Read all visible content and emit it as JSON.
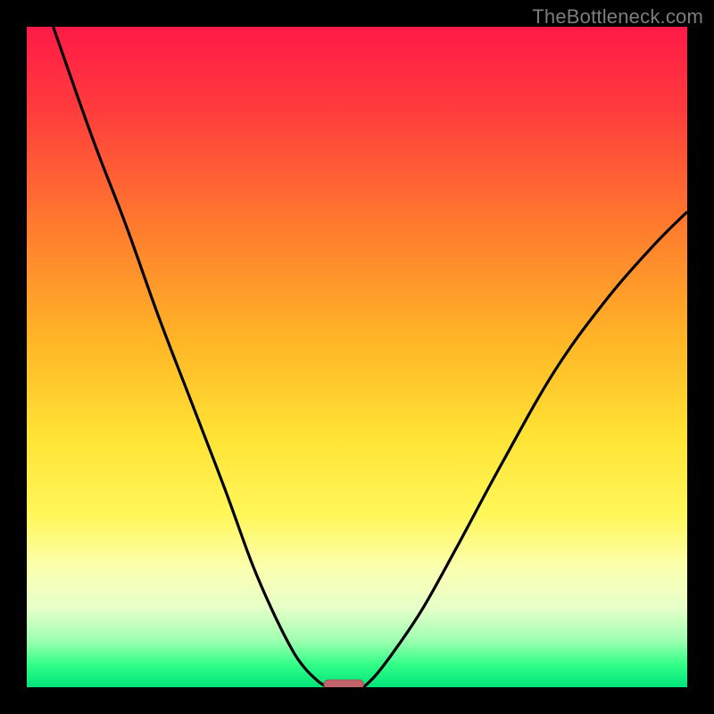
{
  "attribution": "TheBottleneck.com",
  "colors": {
    "frame": "#000000",
    "curve": "#000000",
    "marker_fill": "#c1636a",
    "marker_stroke": "#b04f56",
    "gradient_stops": [
      {
        "offset": 0.0,
        "color": "#ff1a47"
      },
      {
        "offset": 0.12,
        "color": "#ff3a3d"
      },
      {
        "offset": 0.3,
        "color": "#ff7a2e"
      },
      {
        "offset": 0.48,
        "color": "#ffb726"
      },
      {
        "offset": 0.62,
        "color": "#ffe334"
      },
      {
        "offset": 0.74,
        "color": "#fff75a"
      },
      {
        "offset": 0.82,
        "color": "#fbffb0"
      },
      {
        "offset": 0.88,
        "color": "#e6ffc9"
      },
      {
        "offset": 0.93,
        "color": "#9cffb0"
      },
      {
        "offset": 0.965,
        "color": "#33ff88"
      },
      {
        "offset": 1.0,
        "color": "#00e47a"
      }
    ]
  },
  "chart_data": {
    "type": "line",
    "title": "",
    "xlabel": "",
    "ylabel": "",
    "xlim": [
      0,
      100
    ],
    "ylim": [
      0,
      100
    ],
    "series": [
      {
        "name": "left-curve",
        "x": [
          4,
          10,
          15,
          20,
          25,
          30,
          34,
          37,
          40,
          42,
          44,
          45.5
        ],
        "values": [
          100,
          83,
          70,
          56,
          43,
          30,
          19,
          12,
          6,
          3,
          1,
          0
        ]
      },
      {
        "name": "right-curve",
        "x": [
          51,
          53,
          56,
          60,
          65,
          72,
          80,
          88,
          95,
          100
        ],
        "values": [
          0,
          2,
          6,
          12,
          21,
          34,
          48,
          59,
          67,
          72
        ]
      }
    ],
    "marker": {
      "x_center": 48,
      "y": 0.5,
      "width": 6,
      "height": 1.2
    }
  }
}
